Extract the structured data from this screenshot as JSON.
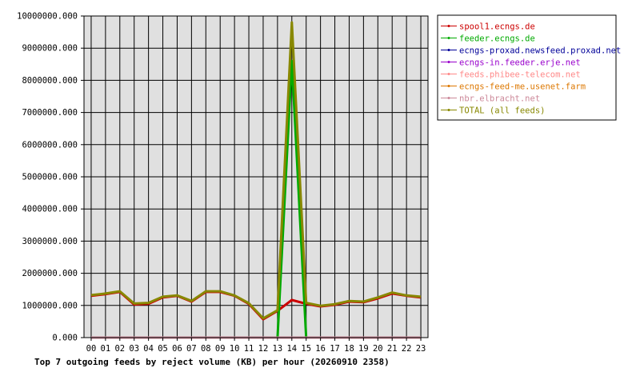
{
  "chart_data": {
    "type": "line",
    "title": "Top 7 outgoing feeds by reject volume (KB) per hour (20260910 2358)",
    "x": [
      "00",
      "01",
      "02",
      "03",
      "04",
      "05",
      "06",
      "07",
      "08",
      "09",
      "10",
      "11",
      "12",
      "13",
      "14",
      "15",
      "16",
      "17",
      "18",
      "19",
      "20",
      "21",
      "22",
      "23"
    ],
    "ylim": [
      0,
      10000000
    ],
    "yticks": [
      "0.000",
      "1000000.000",
      "2000000.000",
      "3000000.000",
      "4000000.000",
      "5000000.000",
      "6000000.000",
      "7000000.000",
      "8000000.000",
      "9000000.000",
      "10000000.000"
    ],
    "grid": true,
    "legend_position": "right",
    "series": [
      {
        "name": "spool1.ecngs.de",
        "color": "#cc0000",
        "values": [
          1300000,
          1350000,
          1420000,
          1030000,
          1050000,
          1250000,
          1300000,
          1120000,
          1420000,
          1420000,
          1300000,
          1050000,
          570000,
          830000,
          1170000,
          1050000,
          970000,
          1020000,
          1120000,
          1100000,
          1220000,
          1370000,
          1300000,
          1250000
        ]
      },
      {
        "name": "feeder.ecngs.de",
        "color": "#00aa00",
        "values": [
          0,
          0,
          0,
          0,
          0,
          0,
          0,
          0,
          0,
          0,
          0,
          0,
          0,
          0,
          8600000,
          0,
          0,
          0,
          0,
          0,
          0,
          0,
          0,
          0
        ]
      },
      {
        "name": "ecngs-proxad.newsfeed.proxad.net",
        "color": "#000099",
        "values": [
          0,
          0,
          0,
          0,
          0,
          0,
          0,
          0,
          0,
          0,
          0,
          0,
          0,
          0,
          0,
          0,
          0,
          0,
          0,
          0,
          0,
          0,
          0,
          0
        ]
      },
      {
        "name": "ecngs-in.feeder.erje.net",
        "color": "#9900cc",
        "values": [
          0,
          0,
          0,
          0,
          0,
          0,
          0,
          0,
          0,
          0,
          0,
          0,
          0,
          0,
          0,
          0,
          0,
          0,
          0,
          0,
          0,
          0,
          0,
          0
        ]
      },
      {
        "name": "feeds.phibee-telecom.net",
        "color": "#ff8888",
        "values": [
          0,
          0,
          0,
          0,
          0,
          0,
          0,
          0,
          0,
          0,
          0,
          0,
          0,
          0,
          0,
          0,
          0,
          0,
          0,
          0,
          0,
          0,
          0,
          0
        ]
      },
      {
        "name": "ecngs-feed-me.usenet.farm",
        "color": "#dd7700",
        "values": [
          0,
          0,
          0,
          0,
          0,
          0,
          0,
          0,
          0,
          0,
          0,
          0,
          0,
          0,
          0,
          0,
          0,
          0,
          0,
          0,
          0,
          0,
          0,
          0
        ]
      },
      {
        "name": "nbr.elbracht.net",
        "color": "#cc8899",
        "values": [
          0,
          0,
          0,
          0,
          0,
          0,
          0,
          0,
          0,
          0,
          0,
          0,
          0,
          0,
          0,
          0,
          0,
          0,
          0,
          0,
          0,
          0,
          0,
          0
        ]
      },
      {
        "name": "TOTAL (all feeds)",
        "color": "#888800",
        "values": [
          1320000,
          1370000,
          1440000,
          1060000,
          1080000,
          1270000,
          1310000,
          1140000,
          1440000,
          1440000,
          1310000,
          1070000,
          600000,
          850000,
          9800000,
          1080000,
          990000,
          1040000,
          1140000,
          1120000,
          1250000,
          1400000,
          1310000,
          1270000
        ]
      }
    ]
  }
}
